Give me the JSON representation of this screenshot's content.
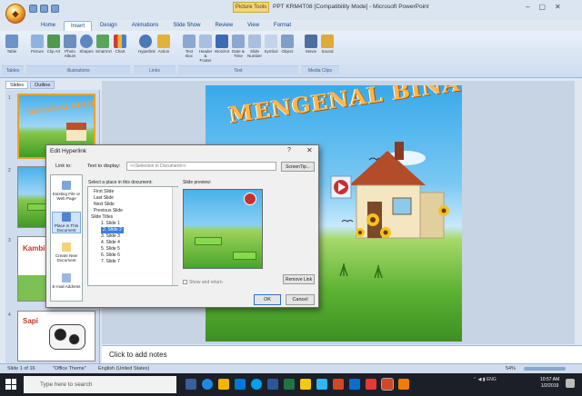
{
  "window": {
    "title": "PPT KRM4T08 [Compatibility Mode] - Microsoft PowerPoint",
    "context_tab": "Picture Tools",
    "controls": [
      "–",
      "▢",
      "✕"
    ]
  },
  "office_button_icon": "office-logo-icon",
  "quick_access": [
    "save-icon",
    "undo-icon",
    "redo-icon"
  ],
  "ribbon": {
    "tabs": [
      "Home",
      "Insert",
      "Design",
      "Animations",
      "Slide Show",
      "Review",
      "View",
      "Format"
    ],
    "active_tab": "Insert",
    "buttons": [
      "Table",
      "Picture",
      "Clip Art",
      "Photo Album",
      "Shapes",
      "SmartArt",
      "Chart",
      "Hyperlink",
      "Action",
      "Text Box",
      "Header & Footer",
      "WordArt",
      "Date & Time",
      "Slide Number",
      "Symbol",
      "Object",
      "Movie",
      "Sound"
    ],
    "groups": [
      "Tables",
      "Illustrations",
      "Links",
      "Text",
      "Media Clips"
    ]
  },
  "left_pane": {
    "tabs": [
      "Slides",
      "Outline"
    ],
    "slide_numbers": [
      "1",
      "2",
      "3",
      "4"
    ],
    "thumb_labels": [
      "MENGENAL BINATANG",
      "Kambing",
      "Sapi"
    ]
  },
  "slide": {
    "title": "MENGENAL BINATANG"
  },
  "notes": {
    "placeholder": "Click to add notes"
  },
  "status": {
    "slide_info": "Slide 1 of 16",
    "theme": "\"Office Theme\"",
    "language": "English (United States)",
    "zoom": "54%"
  },
  "dialog": {
    "title": "Edit Hyperlink",
    "link_to_label": "Link to:",
    "link_to_items": [
      "Existing File or Web Page",
      "Place in This Document",
      "Create New Document",
      "E-mail Address"
    ],
    "selected_link_to": "Place in This Document",
    "text_to_display_label": "Text to display:",
    "text_to_display_value": "<<Selection in Document>>",
    "screentip_button": "ScreenTip...",
    "select_place_label": "Select a place in this document:",
    "places": [
      "First Slide",
      "Last Slide",
      "Next Slide",
      "Previous Slide",
      "Slide Titles",
      "1. Slide 1",
      "2. Slide 2",
      "3. Slide 3",
      "4. Slide 4",
      "5. Slide 5",
      "6. Slide 6",
      "7. Slide 7"
    ],
    "selected_place": "2. Slide 2",
    "slide_preview_label": "Slide preview:",
    "show_return_label": "Show and return",
    "remove_link_button": "Remove Link",
    "ok_button": "OK",
    "cancel_button": "Cancel",
    "help_label": "?",
    "close_label": "✕"
  },
  "taskbar": {
    "search_placeholder": "Type here to search",
    "time": "10:57 AM",
    "date": "1/2/2019"
  },
  "colors": {
    "ribbon_bg": "#dbe5f1",
    "title_text": "#ffb54a",
    "taskbar_bg": "#1c1f27",
    "selection": "#3b7fd8"
  }
}
